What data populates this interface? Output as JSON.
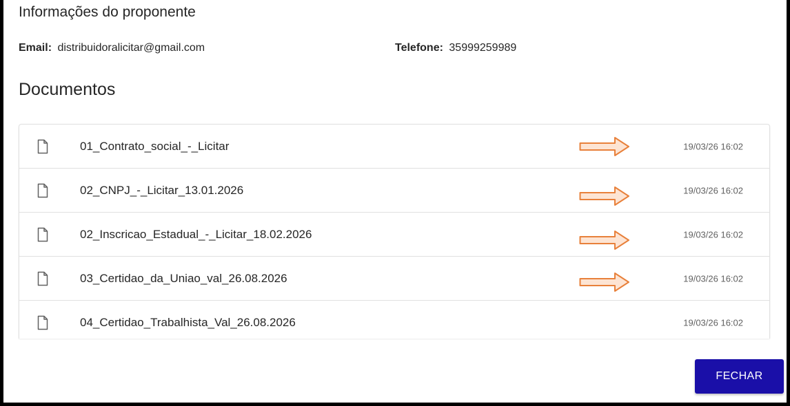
{
  "proponent": {
    "heading": "Informações do proponente",
    "email_label": "Email:",
    "email_value": "distribuidoralicitar@gmail.com",
    "phone_label": "Telefone:",
    "phone_value": "35999259989"
  },
  "documents": {
    "heading": "Documentos",
    "items": [
      {
        "name": "01_Contrato_social_-_Licitar",
        "date": "19/03/26 16:02",
        "highlighted": true
      },
      {
        "name": "02_CNPJ_-_Licitar_13.01.2026",
        "date": "19/03/26 16:02",
        "highlighted": true
      },
      {
        "name": "02_Inscricao_Estadual_-_Licitar_18.02.2026",
        "date": "19/03/26 16:02",
        "highlighted": true
      },
      {
        "name": "03_Certidao_da_Uniao_val_26.08.2026",
        "date": "19/03/26 16:02",
        "highlighted": true
      },
      {
        "name": "04_Certidao_Trabalhista_Val_26.08.2026",
        "date": "19/03/26 16:02",
        "highlighted": false
      }
    ],
    "item_icon": "file-icon"
  },
  "actions": {
    "close_label": "FECHAR"
  },
  "colors": {
    "primary_button": "#1a0fa8",
    "annotation_arrow_fill": "#fde4d3",
    "annotation_arrow_stroke": "#e8803a"
  }
}
